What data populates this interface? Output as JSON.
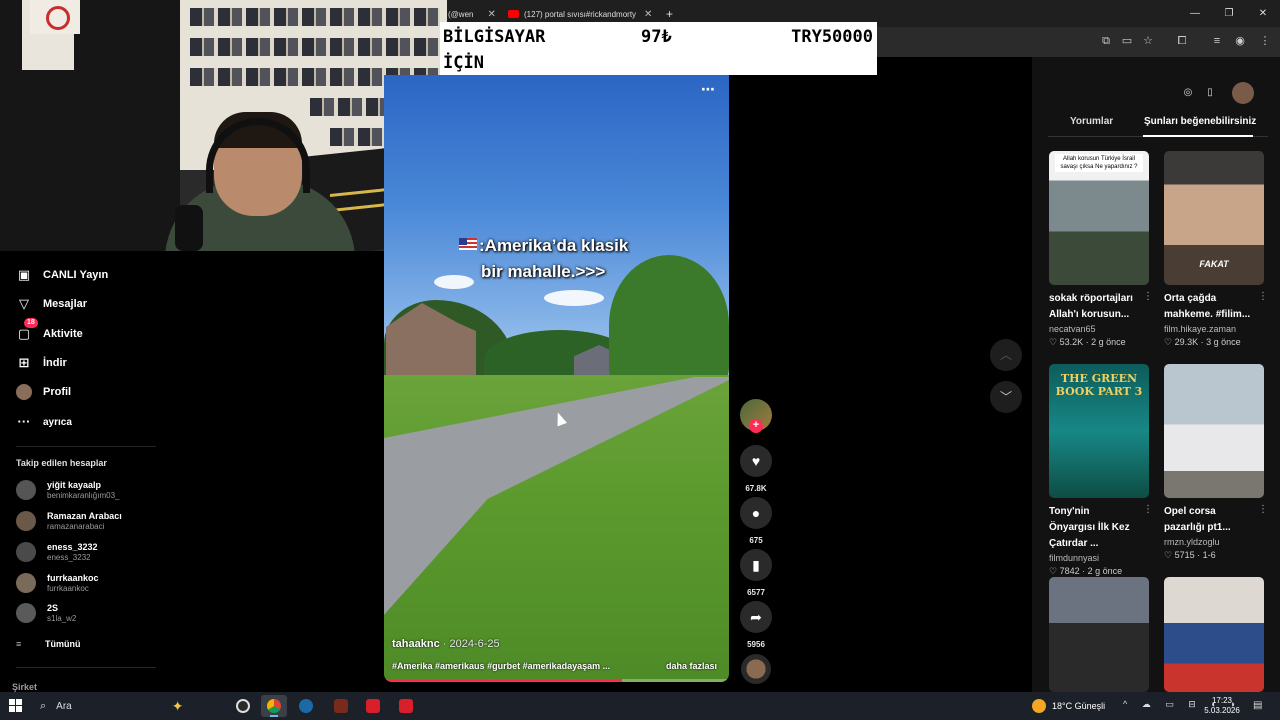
{
  "browser": {
    "tabs": [
      {
        "title": "(@wen"
      },
      {
        "title": "(127) portal sıvısı#rickandmorty"
      }
    ],
    "new_tab": "+",
    "window_controls": [
      "—",
      "❐",
      "✕"
    ]
  },
  "overlay": {
    "line1": "BİLGİSAYAR",
    "line2": "İÇİN",
    "amount": "97₺",
    "goal": "TRY50000"
  },
  "sidebar": {
    "items": [
      {
        "label": "CANLI Yayın",
        "icon": "live-tv-icon"
      },
      {
        "label": "Mesajlar",
        "icon": "paper-plane-icon"
      },
      {
        "label": "Aktivite",
        "icon": "activity-icon",
        "badge": "18"
      },
      {
        "label": "İndir",
        "icon": "plus-square-icon"
      },
      {
        "label": "Profil",
        "icon": "profile-avatar"
      },
      {
        "label": "ayrıca",
        "icon": "more-icon"
      }
    ],
    "following_title": "Takip edilen hesaplar",
    "following": [
      {
        "name": "yiğit kayaalp",
        "handle": "benimkaranlığım03_"
      },
      {
        "name": "Ramazan Arabacı",
        "handle": "ramazanarabaci"
      },
      {
        "name": "eness_3232",
        "handle": "eness_3232"
      },
      {
        "name": "furrkaankoc",
        "handle": "furrkaankoc"
      },
      {
        "name": "2S",
        "handle": "s1la_w2"
      }
    ],
    "see_all": "Tümünü",
    "company": "Şirket"
  },
  "video": {
    "caption_line1": ":Amerika’da klasik",
    "caption_line2": "bir mahalle.>>>",
    "more_icon": "⋯",
    "author": "tahaaknc",
    "date": " · 2024-6-25",
    "tags": "#Amerika #amerikaus #gurbet #amerikadayaşam ...",
    "more_link": "daha fazlası",
    "progress": 0.69
  },
  "actions": {
    "likes": "67.8K",
    "comments": "675",
    "saves": "6577",
    "shares": "5956",
    "follow_plus": "+"
  },
  "right_panel": {
    "tabs": [
      "Yorumlar",
      "Şunları beğenebilirsiniz"
    ],
    "cards": [
      {
        "title": "sokak röportajları Allah'ı korusun...",
        "author": "necatvan65",
        "meta": "♡ 53.2K · 2 g önce",
        "thumb_text": "Allah korusun Türkiye İsrail savaşı çıksa Ne yapardınız ?"
      },
      {
        "title": "Orta çağda mahkeme. #filim...",
        "author": "film.hikaye.zaman",
        "meta": "♡ 29.3K · 3 g önce",
        "thumb_text": "FAKAT"
      },
      {
        "title": "Tony'nin Önyargısı İlk Kez Çatırdar ...",
        "author": "filmdunnyasi",
        "meta": "♡ 7842 · 2 g önce",
        "thumb_text": "THE GREEN BOOK PART 3"
      },
      {
        "title": "Opel corsa pazarlığı pt1...",
        "author": "rmzn.yldzoglu",
        "meta": "♡ 5715 · 1-6",
        "thumb_text": ""
      }
    ]
  },
  "taskbar": {
    "search": "Ara",
    "weather": "18°C  Güneşli",
    "time": "17:23",
    "date": "5.03.2026"
  }
}
